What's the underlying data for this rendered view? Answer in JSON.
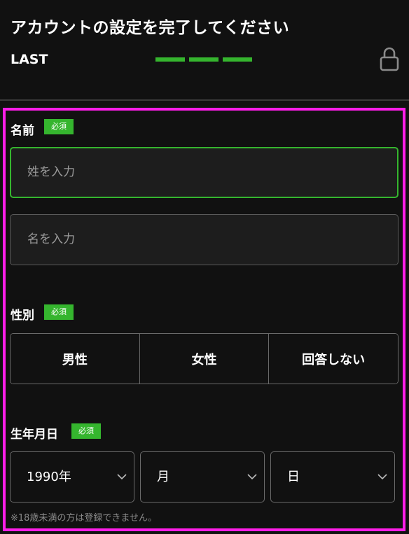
{
  "header": {
    "title": "アカウントの設定を完了してください",
    "step_label": "LAST",
    "progress_filled_segments": 3,
    "lock_icon": "lock-icon"
  },
  "form": {
    "name": {
      "label": "名前",
      "badge": "必須",
      "last_name_placeholder": "姓を入力",
      "first_name_placeholder": "名を入力"
    },
    "gender": {
      "label": "性別",
      "badge": "必須",
      "options": [
        "男性",
        "女性",
        "回答しない"
      ]
    },
    "birthday": {
      "label": "生年月日",
      "badge": "必須",
      "year_value": "1990年",
      "month_value": "月",
      "day_value": "日",
      "note": "※18歳未満の方は登録できません。"
    }
  },
  "colors": {
    "accent_green": "#35b52e",
    "highlight_border": "#ff1ee8",
    "background": "#111111"
  }
}
